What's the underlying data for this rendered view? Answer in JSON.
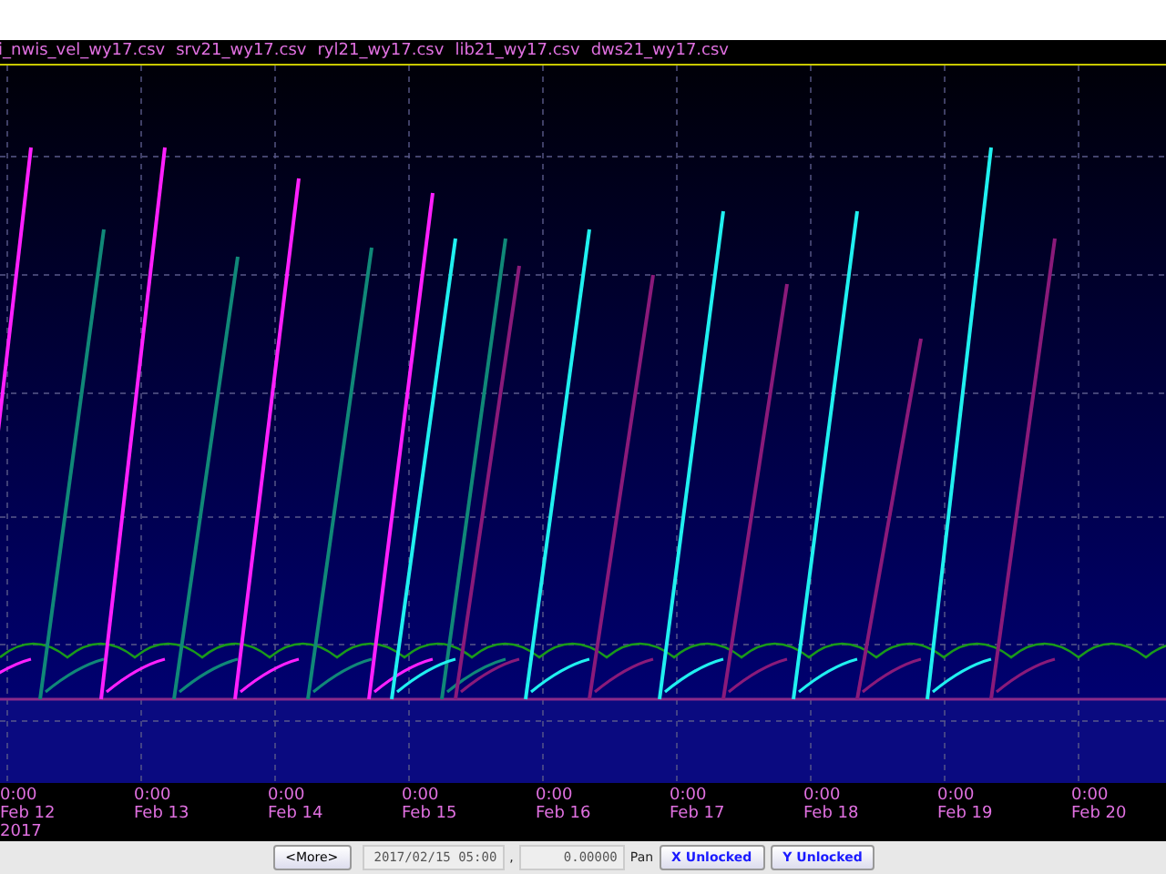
{
  "legend": [
    "i_nwis_vel_wy17.csv",
    "srv21_wy17.csv",
    "ryl21_wy17.csv",
    "lib21_wy17.csv",
    "dws21_wy17.csv"
  ],
  "x_axis": {
    "ticks": [
      {
        "time": "0:00",
        "date": "Feb 12",
        "year": "2017"
      },
      {
        "time": "0:00",
        "date": "Feb 13"
      },
      {
        "time": "0:00",
        "date": "Feb 14"
      },
      {
        "time": "0:00",
        "date": "Feb 15"
      },
      {
        "time": "0:00",
        "date": "Feb 16"
      },
      {
        "time": "0:00",
        "date": "Feb 17"
      },
      {
        "time": "0:00",
        "date": "Feb 18"
      },
      {
        "time": "0:00",
        "date": "Feb 19"
      },
      {
        "time": "0:00",
        "date": "Feb 20"
      }
    ]
  },
  "toolbar": {
    "more_button": "<More>",
    "time_field": "2017/02/15 05:00",
    "separator": ",",
    "value_field": "0.00000",
    "pan_label": "Pan",
    "x_lock_button": "X Unlocked",
    "y_lock_button": "Y Unlocked"
  }
}
